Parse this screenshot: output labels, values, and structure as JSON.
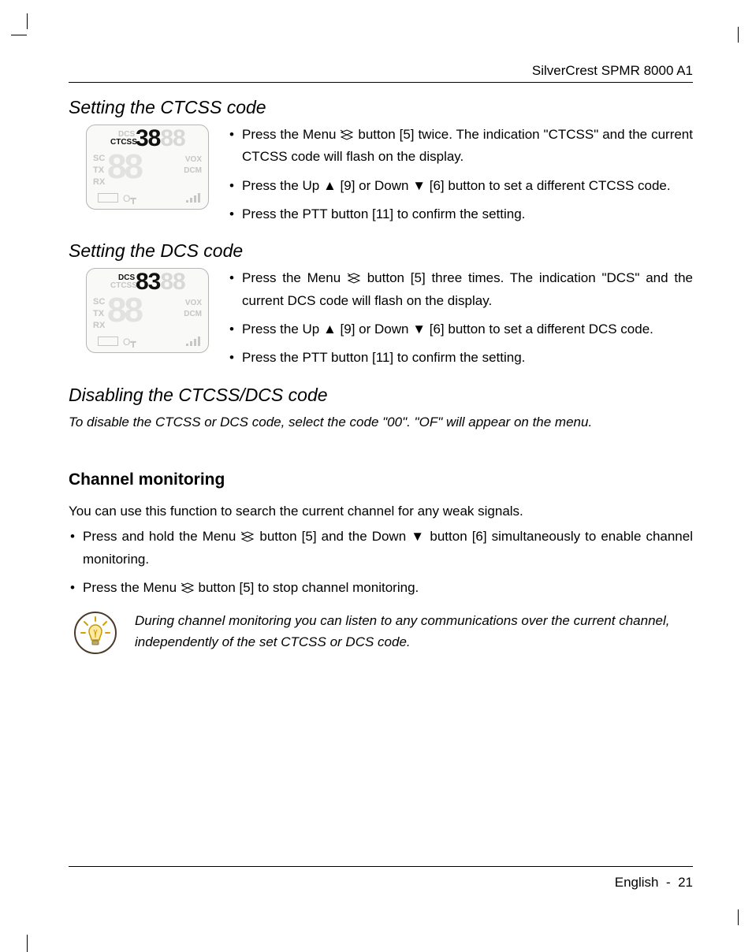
{
  "header": {
    "product": "SilverCrest SPMR 8000 A1"
  },
  "sections": {
    "ctcss": {
      "title": "Setting the CTCSS code",
      "lcd_top_value": "38",
      "items": [
        "Press the Menu  button [5] twice. The indication \"CTCSS\" and the current CTCSS code will flash on the display.",
        "Press the Up ▲ [9] or Down ▼ [6] button to set a different CTCSS code.",
        "Press the PTT button [11] to confirm the setting."
      ]
    },
    "dcs": {
      "title": "Setting the DCS code",
      "lcd_top_value": "83",
      "items": [
        "Press the Menu  button [5] three times. The indication \"DCS\" and the current DCS code will flash on the display.",
        "Press the Up ▲ [9] or Down ▼ [6] button to set a different DCS code.",
        "Press the PTT button [11] to confirm the setting."
      ]
    },
    "disable": {
      "title": "Disabling the CTCSS/DCS code",
      "note": "To disable the CTCSS or DCS code, select the code \"00\". \"OF\" will appear on the menu."
    },
    "channel": {
      "title": "Channel monitoring",
      "intro": "You can use this function to search the current channel for any weak signals.",
      "items": [
        "Press and hold the Menu  button [5] and the Down ▼ button [6] simultaneously to enable channel monitoring.",
        "Press the Menu  button [5] to stop channel monitoring."
      ],
      "tip": "During channel monitoring you can listen to any communications over the current channel, independently of the set CTCSS or DCS code."
    }
  },
  "footer": {
    "language": "English",
    "page": "21"
  },
  "icons": {
    "labels": {
      "DCS": "DCS",
      "CTCSS": "CTCSS",
      "SC": "SC",
      "TX": "TX",
      "RX": "RX",
      "VOX": "VOX",
      "DCM": "DCM"
    }
  }
}
